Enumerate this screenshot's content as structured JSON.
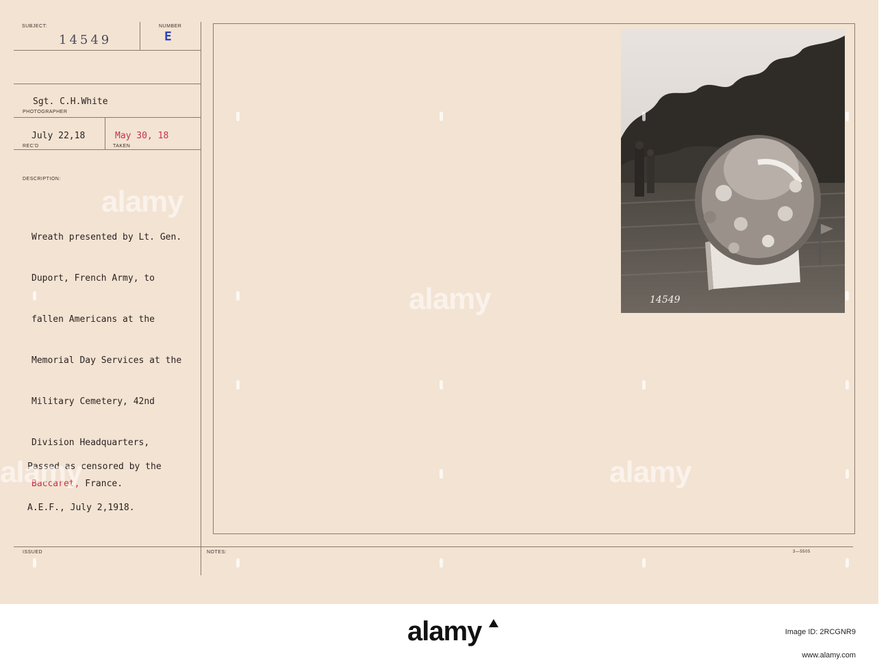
{
  "record": {
    "subject_label": "SUBJECT:",
    "subject_value": "14549",
    "number_label": "NUMBER",
    "number_value": "E",
    "photographer_value": "Sgt. C.H.White",
    "photographer_label": "PHOTOGRAPHER",
    "received_value": "July 22,18",
    "received_label": "REC'D",
    "taken_value": "May 30, 18",
    "taken_label": "TAKEN",
    "description_label": "DESCRIPTION:",
    "description_lines": [
      "Wreath presented by Lt. Gen.",
      "Duport, French Army, to",
      "fallen Americans at the",
      "Memorial Day Services at the",
      "Military Cemetery, 42nd",
      "Division Headquarters,"
    ],
    "description_place": "Baccaret,",
    "description_country": " France.",
    "censor_lines": [
      "Passed as censored by the",
      "A.E.F., July 2,1918."
    ],
    "issued_label": "ISSUED",
    "notes_label": "NOTES:",
    "form_number": "3—5505",
    "photo_caption": "14549"
  },
  "watermark": {
    "text": "alamy"
  },
  "footer": {
    "brand": "alamy",
    "image_id": "Image ID: 2RCGNR9",
    "site": "www.alamy.com"
  },
  "colors": {
    "card": "#f3e3d3",
    "red_ink": "#c8324a",
    "blue_stamp": "#2a44b8"
  }
}
